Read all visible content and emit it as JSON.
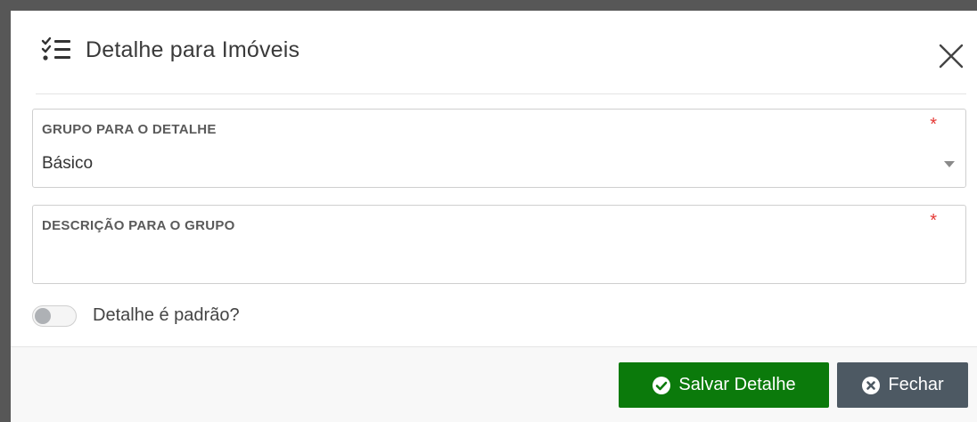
{
  "modal": {
    "title": "Detalhe para Imóveis",
    "header_icon": "checklist-icon",
    "close_icon": "close-icon"
  },
  "form": {
    "group_field": {
      "label": "GRUPO PARA O DETALHE",
      "required_mark": "*",
      "selected_value": "Básico"
    },
    "description_field": {
      "label": "DESCRIÇÃO PARA O GRUPO",
      "required_mark": "*",
      "value": ""
    },
    "default_toggle": {
      "label": "Detalhe é padrão?",
      "checked": false
    }
  },
  "footer": {
    "save_label": "Salvar Detalhe",
    "save_icon": "check-circle-icon",
    "close_label": "Fechar",
    "close_icon": "times-circle-icon"
  },
  "colors": {
    "save_button": "#0b7a0b",
    "close_button": "#4d5963",
    "required": "#e53935"
  }
}
